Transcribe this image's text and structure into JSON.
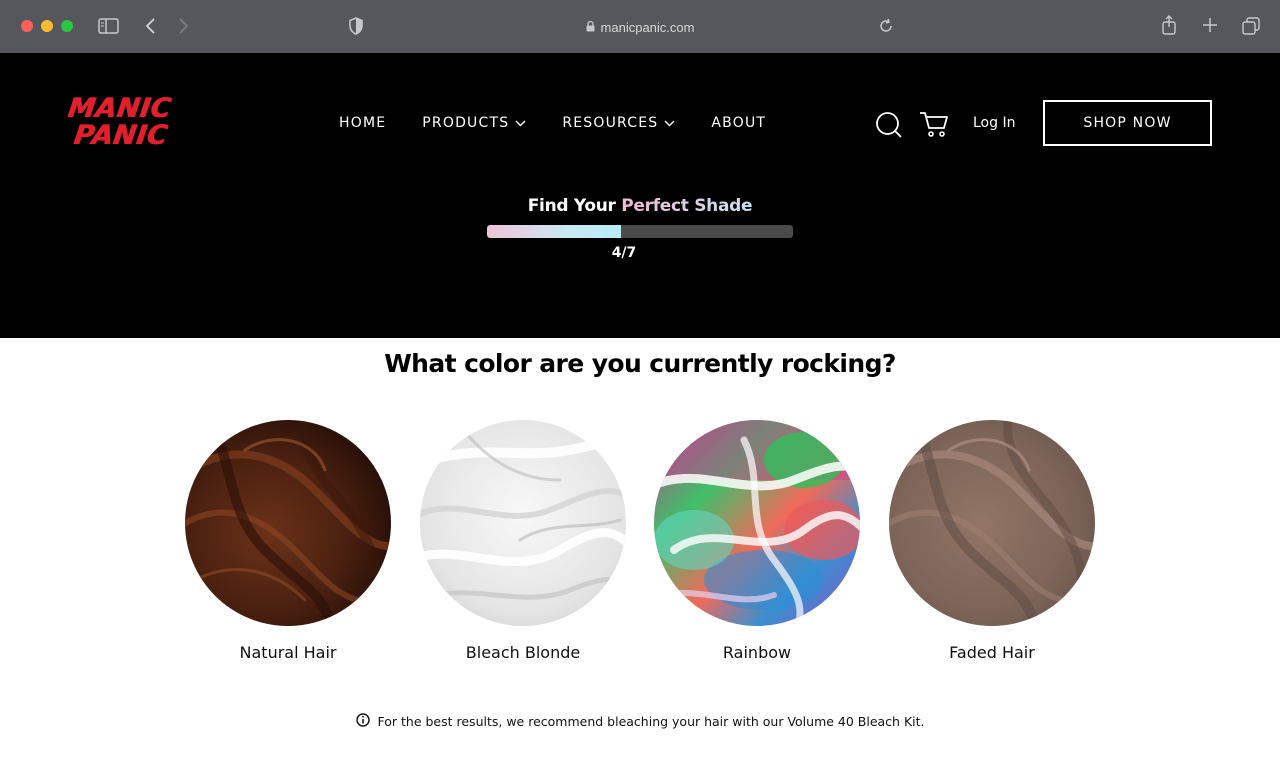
{
  "browser": {
    "url": "manicpanic.com"
  },
  "header": {
    "logo_line1": "MANIC",
    "logo_line2": "PANIC",
    "nav": {
      "home": "HOME",
      "products": "PRODUCTS",
      "resources": "RESOURCES",
      "about": "ABOUT"
    },
    "login": "Log In",
    "shop_now": "SHOP NOW"
  },
  "quiz": {
    "title_part1": "Find Your",
    "title_part2": "Perfect Shade",
    "progress": 0.4375,
    "step": "4/7",
    "question": "What color are you currently rocking?",
    "options": [
      {
        "label": "Natural Hair"
      },
      {
        "label": "Bleach Blonde"
      },
      {
        "label": "Rainbow"
      },
      {
        "label": "Faded Hair"
      }
    ],
    "note": "For the best results, we recommend bleaching your hair with our Volume 40 Bleach Kit."
  },
  "colors": {
    "brand_red": "#e0202c",
    "header_bg": "#000000"
  }
}
